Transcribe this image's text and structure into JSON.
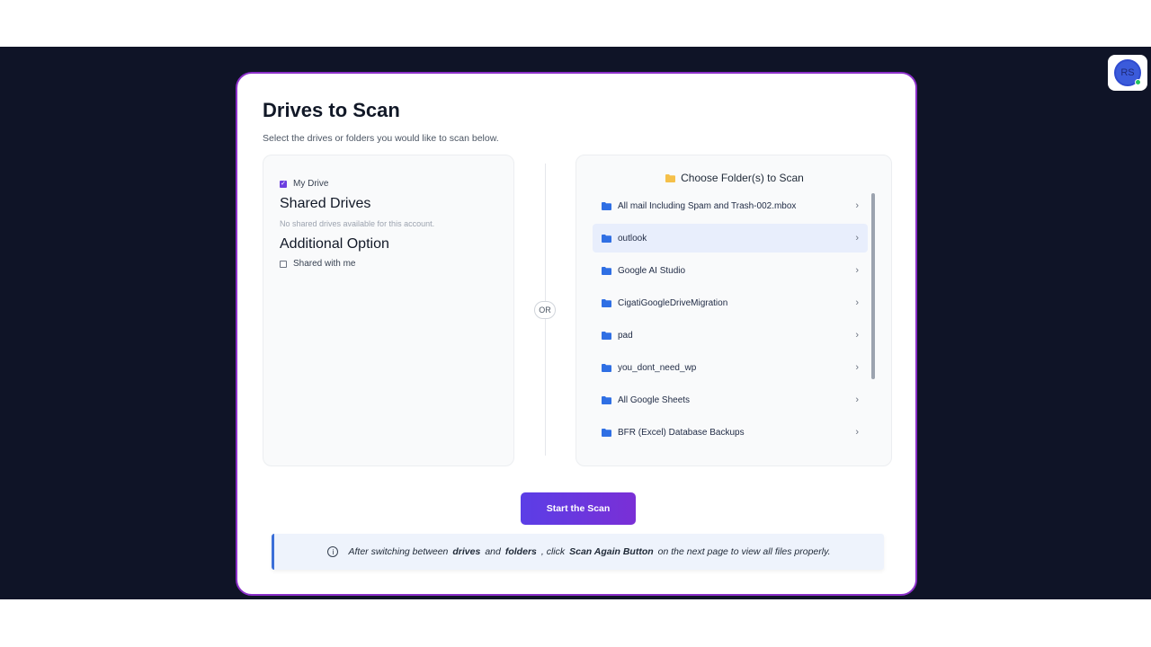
{
  "user": {
    "initials": "RS"
  },
  "page": {
    "title": "Drives to Scan",
    "subtitle": "Select the drives or folders you would like to scan below."
  },
  "drives": {
    "my_drive_label": "My Drive",
    "my_drive_checked": true,
    "shared_heading": "Shared Drives",
    "shared_note": "No shared drives available for this account.",
    "additional_heading": "Additional Option",
    "shared_with_me_label": "Shared with me",
    "shared_with_me_checked": false
  },
  "divider": {
    "label": "OR"
  },
  "folders": {
    "heading": "Choose Folder(s) to Scan",
    "items": [
      {
        "name": "All mail Including Spam and Trash-002.mbox",
        "selected": false
      },
      {
        "name": "outlook",
        "selected": true
      },
      {
        "name": "Google AI Studio",
        "selected": false
      },
      {
        "name": "CigatiGoogleDriveMigration",
        "selected": false
      },
      {
        "name": "pad",
        "selected": false
      },
      {
        "name": "you_dont_need_wp",
        "selected": false
      },
      {
        "name": "All Google Sheets",
        "selected": false
      },
      {
        "name": "BFR (Excel) Database Backups",
        "selected": false
      }
    ]
  },
  "actions": {
    "start_label": "Start the Scan"
  },
  "info": {
    "part1": "After switching between",
    "drives": "drives",
    "and": "and",
    "folders": "folders",
    "comma_click": ", click",
    "button_name": "Scan Again Button",
    "part2": "on the next page to view all files properly."
  },
  "colors": {
    "accent": "#6d3fe0",
    "card_border": "#8b2fc9",
    "folder_icon": "#2f6fe4",
    "header_folder_icon": "#f5c04a",
    "background": "#0f1427"
  }
}
